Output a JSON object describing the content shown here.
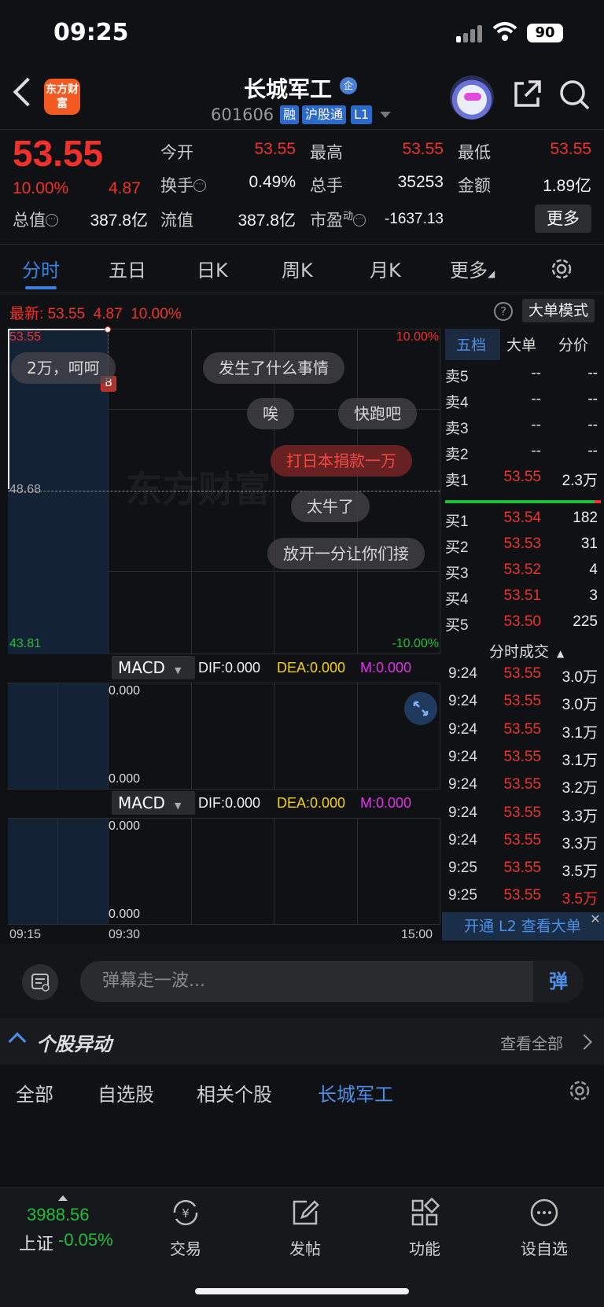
{
  "status_bar": {
    "time": "09:25",
    "battery": "90"
  },
  "header": {
    "logo_text": "东方财富",
    "stock_name": "长城军工",
    "name_badge": "企",
    "stock_code": "601606",
    "tags": [
      "融",
      "沪股通",
      "L1"
    ]
  },
  "quote": {
    "price": "53.55",
    "change_pct": "10.00%",
    "change": "4.87",
    "open_label": "今开",
    "open": "53.55",
    "high_label": "最高",
    "high": "53.55",
    "low_label": "最低",
    "low": "53.55",
    "turnover_label": "换手",
    "turnover": "0.49%",
    "volume_label": "总手",
    "volume": "35253",
    "amount_label": "金额",
    "amount": "1.89亿",
    "mktcap_label": "总值",
    "mktcap": "387.8亿",
    "float_label": "流值",
    "float": "387.8亿",
    "pe_label": "市盈",
    "pe_sup": "动",
    "pe": "-1637.13",
    "more_label": "更多"
  },
  "chart_tabs": [
    "分时",
    "五日",
    "日K",
    "周K",
    "月K",
    "更多"
  ],
  "latest_bar": {
    "label": "最新:",
    "price": "53.55",
    "change": "4.87",
    "pct": "10.00%",
    "mode_button": "大单模式",
    "help": "?"
  },
  "chart": {
    "price_top": "53.55",
    "price_mid": "48.68",
    "price_bottom": "43.81",
    "pct_top": "10.00%",
    "pct_bottom": "-10.00%",
    "buy_marker": "B",
    "time_labels": [
      "09:15",
      "09:30",
      "15:00"
    ],
    "watermark": "东方财富"
  },
  "indicators": [
    {
      "name": "MACD",
      "dif": "DIF:0.000",
      "dea": "DEA:0.000",
      "m": "M:0.000",
      "top": "0.000",
      "bottom": "0.000"
    },
    {
      "name": "MACD",
      "dif": "DIF:0.000",
      "dea": "DEA:0.000",
      "m": "M:0.000",
      "top": "0.000",
      "bottom": "0.000"
    }
  ],
  "danmaku": [
    "2万，呵呵",
    "发生了什么事情",
    "唉",
    "快跑吧",
    "打日本捐款一万",
    "太牛了",
    "放开一分让你们接"
  ],
  "orderbook": {
    "tabs": [
      "五档",
      "大单",
      "分价"
    ],
    "asks": [
      {
        "label": "卖5",
        "price": "--",
        "vol": "--"
      },
      {
        "label": "卖4",
        "price": "--",
        "vol": "--"
      },
      {
        "label": "卖3",
        "price": "--",
        "vol": "--"
      },
      {
        "label": "卖2",
        "price": "--",
        "vol": "--"
      },
      {
        "label": "卖1",
        "price": "53.55",
        "vol": "2.3万"
      }
    ],
    "bids": [
      {
        "label": "买1",
        "price": "53.54",
        "vol": "182"
      },
      {
        "label": "买2",
        "price": "53.53",
        "vol": "31"
      },
      {
        "label": "买3",
        "price": "53.52",
        "vol": "4"
      },
      {
        "label": "买4",
        "price": "53.51",
        "vol": "3"
      },
      {
        "label": "买5",
        "price": "53.50",
        "vol": "225"
      }
    ],
    "trades_title": "分时成交",
    "trades": [
      {
        "time": "9:24",
        "price": "53.55",
        "vol": "3.0万"
      },
      {
        "time": "9:24",
        "price": "53.55",
        "vol": "3.0万"
      },
      {
        "time": "9:24",
        "price": "53.55",
        "vol": "3.1万"
      },
      {
        "time": "9:24",
        "price": "53.55",
        "vol": "3.1万"
      },
      {
        "time": "9:24",
        "price": "53.55",
        "vol": "3.2万"
      },
      {
        "time": "9:24",
        "price": "53.55",
        "vol": "3.3万"
      },
      {
        "time": "9:24",
        "price": "53.55",
        "vol": "3.3万"
      },
      {
        "time": "9:25",
        "price": "53.55",
        "vol": "3.5万"
      },
      {
        "time": "9:25",
        "price": "53.55",
        "vol": "3.5万"
      }
    ],
    "l2_banner": "开通 L2 查看大单"
  },
  "comment": {
    "placeholder": "弹幕走一波...",
    "send": "弹"
  },
  "stock_move": {
    "title": "个股异动",
    "view_all": "查看全部",
    "filters": [
      "全部",
      "自选股",
      "相关个股",
      "长城军工"
    ]
  },
  "bottom_nav": {
    "index_value": "3988.56",
    "index_name": "上证",
    "index_pct": "-0.05%",
    "items": [
      "交易",
      "发帖",
      "功能",
      "设自选"
    ]
  },
  "colors": {
    "up": "#f0312b",
    "down": "#1fbf3a",
    "accent": "#3b82e0",
    "background": "#101114"
  }
}
